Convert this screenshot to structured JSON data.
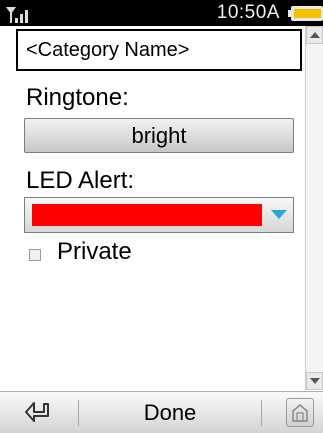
{
  "status_bar": {
    "time": "10:50A",
    "signal_icon": "signal-icon",
    "battery_icon": "battery-icon",
    "battery_color": "#f2c200"
  },
  "form": {
    "category_name": "<Category Name>",
    "ringtone_label": "Ringtone:",
    "ringtone_value": "bright",
    "led_label": "LED Alert:",
    "led_color": "#ff0000",
    "private_label": "Private",
    "private_checked": false
  },
  "bottom_bar": {
    "back_icon": "back-arrow-icon",
    "done_label": "Done",
    "home_icon": "home-icon"
  },
  "colors": {
    "dropdown_arrow": "#29a8d8"
  }
}
